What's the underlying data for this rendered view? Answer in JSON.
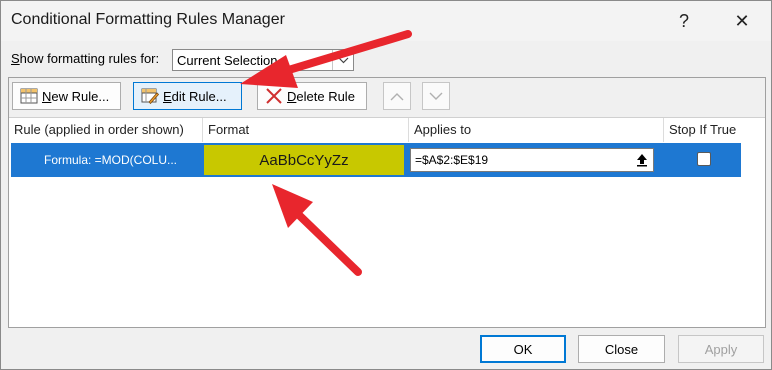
{
  "window": {
    "title": "Conditional Formatting Rules Manager",
    "help_glyph": "?",
    "close_glyph": "✕"
  },
  "show_rules": {
    "label_underlined": "S",
    "label_rest": "how formatting rules for:",
    "selected": "Current Selection"
  },
  "toolbar": {
    "new_rule_underlined": "N",
    "new_rule_rest": "ew Rule...",
    "edit_rule_underlined": "E",
    "edit_rule_rest": "dit Rule...",
    "delete_rule_underlined": "D",
    "delete_rule_rest": "elete Rule"
  },
  "columns": [
    "Rule (applied in order shown)",
    "Format",
    "Applies to",
    "Stop If True"
  ],
  "rules": [
    {
      "rule": "Formula: =MOD(COLU...",
      "format_preview": "AaBbCcYyZz",
      "format_color": "#c8c800",
      "applies_to": "=$A$2:$E$19",
      "stop_if_true": false
    }
  ],
  "footer": {
    "ok": "OK",
    "close": "Close",
    "apply": "Apply"
  },
  "colors": {
    "selection": "#1e78d2",
    "annotation_arrow": "#e8262d"
  }
}
